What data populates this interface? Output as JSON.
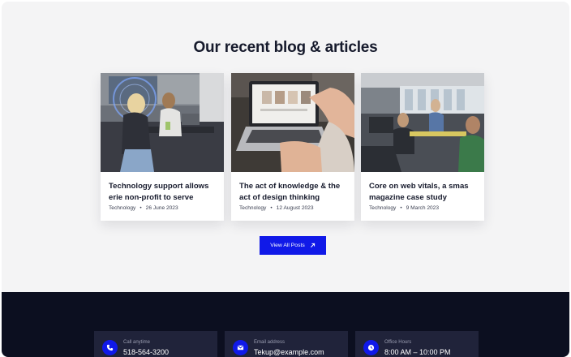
{
  "blog": {
    "title": "Our recent blog & articles",
    "button_label": "View All Posts",
    "button_icon": "arrow-up-right-icon",
    "accent_color": "#1019e8",
    "articles": [
      {
        "title": "Technology support allows erie non-profit to serve",
        "category": "Technology",
        "separator": "•",
        "date": "26 June 2023",
        "image": "office-meeting-photo"
      },
      {
        "title": "The act of knowledge & the act of design thinking",
        "category": "Technology",
        "separator": "•",
        "date": "12 August 2023",
        "image": "laptop-touch-photo"
      },
      {
        "title": "Core on web vitals, a smas magazine case study",
        "category": "Technology",
        "separator": "•",
        "date": "9 March 2023",
        "image": "open-office-photo"
      }
    ]
  },
  "footer": {
    "background_color": "#0c0f20",
    "contacts": [
      {
        "label": "Call anytime",
        "value": "518-564-3200",
        "icon": "phone-icon"
      },
      {
        "label": "Email address",
        "value": "Tekup@example.com",
        "icon": "mail-icon"
      },
      {
        "label": "Office Hours",
        "value": "8:00 AM – 10:00 PM",
        "icon": "clock-icon"
      }
    ]
  }
}
